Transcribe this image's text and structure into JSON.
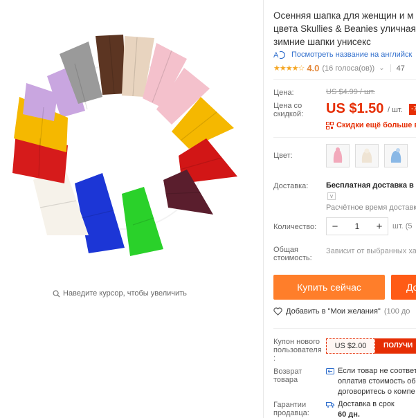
{
  "gallery": {
    "zoom_hint": "Наведите курсор, чтобы увеличить"
  },
  "product": {
    "title_line1": "Осенняя шапка для женщин и м",
    "title_line2": "цвета Skullies & Beanies уличная",
    "title_line3": "зимние шапки унисекс",
    "translate_link": "Посмотреть название на английск",
    "rating": {
      "stars": "★★★★☆",
      "value": "4.0",
      "count": "(16 голоса(ов))",
      "orders": "47"
    }
  },
  "price": {
    "label": "Цена:",
    "old": "US $4.99 / шт.",
    "discount_label_line1": "Цена со",
    "discount_label_line2": "скидкой:",
    "new": "US $1.50",
    "per_unit": "/ шт.",
    "badge": "-7",
    "coupons_more": "Скидки ещё больше в"
  },
  "color": {
    "label": "Цвет:",
    "swatches": [
      "pink-hat",
      "cream-hat",
      "blue-hat"
    ]
  },
  "delivery": {
    "label": "Доставка:",
    "main": "Бесплатная доставка в",
    "time": "Расчётное время доставк"
  },
  "quantity": {
    "label": "Количество:",
    "minus": "−",
    "value": "1",
    "plus": "+",
    "unit": "шт. (5"
  },
  "total": {
    "label_line1": "Общая",
    "label_line2": "стоимость:",
    "note": "Зависит от выбранных ха"
  },
  "actions": {
    "buy_now": "Купить сейчас",
    "add_to_cart": "Дo"
  },
  "wishlist": {
    "label": "Добавить в \"Мои желания\"",
    "count": "(100 до"
  },
  "new_user_coupon": {
    "label_line1": "Купон нового",
    "label_line2": "пользователя",
    "label_line3": ":",
    "amount": "US $2.00",
    "get": "ПОЛУЧИ"
  },
  "returns": {
    "label_line1": "Возврат",
    "label_line2": "товара",
    "text_line1": "Если товар не соответ",
    "text_line2": "оплатив стоимость об",
    "text_line3": "договоритесь о компе"
  },
  "seller_guarantee": {
    "label_line1": "Гарантии",
    "label_line2": "продавца:",
    "text_line1": "Доставка в срок",
    "text_line2": "60 дн."
  },
  "colors": {
    "accent": "#e62e04",
    "buy_button": "#ff7e2a",
    "cart_button": "#ff5b16",
    "link": "#2e6dcc",
    "star": "#f5a623"
  }
}
